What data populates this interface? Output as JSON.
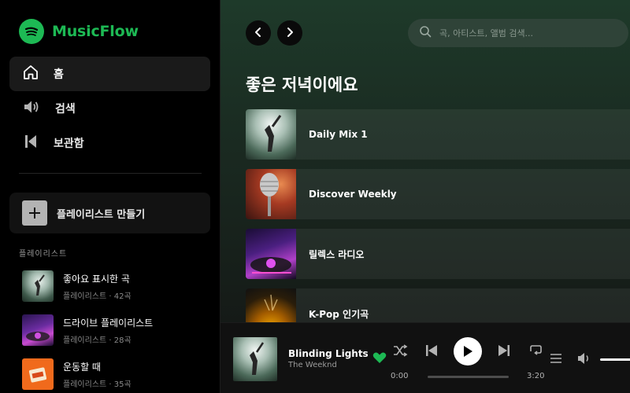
{
  "app": {
    "name": "MusicFlow",
    "brand_color": "#1db954"
  },
  "sidebar": {
    "nav": [
      {
        "label": "홈",
        "icon": "home-icon",
        "active": true
      },
      {
        "label": "검색",
        "icon": "speaker-icon",
        "active": false
      },
      {
        "label": "보관함",
        "icon": "library-icon",
        "active": false
      }
    ],
    "create_playlist_label": "플레이리스트 만들기",
    "section_title": "플레이리스트",
    "playlists": [
      {
        "title": "좋아요 표시한 곡",
        "subtitle": "플레이리스트 · 42곡"
      },
      {
        "title": "드라이브 플레이리스트",
        "subtitle": "플레이리스트 · 28곡"
      },
      {
        "title": "운동할 때",
        "subtitle": "플레이리스트 · 35곡"
      }
    ]
  },
  "header": {
    "search_placeholder": "곡, 아티스트, 앨범 검색..."
  },
  "main": {
    "greeting": "좋은 저녁이에요",
    "cards": [
      {
        "title": "Daily Mix 1"
      },
      {
        "title": "Discover Weekly"
      },
      {
        "title": "릴렉스 라디오"
      },
      {
        "title": "K-Pop 인기곡"
      }
    ]
  },
  "player": {
    "track_title": "Blinding Lights",
    "artist": "The Weeknd",
    "current_time": "0:00",
    "duration": "3:20",
    "progress": 0,
    "liked": true,
    "volume": 1.0
  }
}
